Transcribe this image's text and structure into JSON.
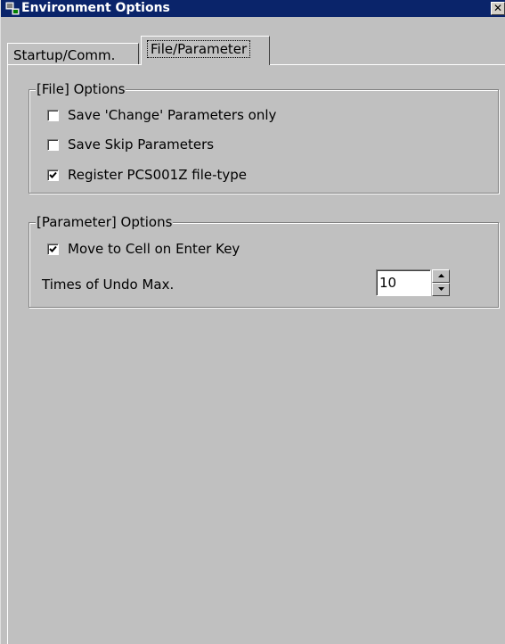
{
  "window": {
    "title": "Environment Options",
    "close_glyph": "✕",
    "colors": {
      "titlebar": "#0a246a",
      "face": "#c0c0c0"
    }
  },
  "tabs": [
    {
      "label": "Startup/Comm.",
      "selected": false
    },
    {
      "label": "File/Parameter",
      "selected": true
    }
  ],
  "file_options": {
    "legend": "[File] Options",
    "items": [
      {
        "label": "Save 'Change' Parameters only",
        "checked": false
      },
      {
        "label": "Save Skip Parameters",
        "checked": false
      },
      {
        "label": "Register PCS001Z file-type",
        "checked": true
      }
    ]
  },
  "parameter_options": {
    "legend": "[Parameter] Options",
    "move_to_cell": {
      "label": "Move to Cell on Enter Key",
      "checked": true
    },
    "undo_max": {
      "label": "Times of Undo Max.",
      "value": "10"
    }
  },
  "icons": [
    "app-icon",
    "close-icon",
    "checkmark-icon",
    "spin-up-arrow-icon",
    "spin-down-arrow-icon"
  ]
}
